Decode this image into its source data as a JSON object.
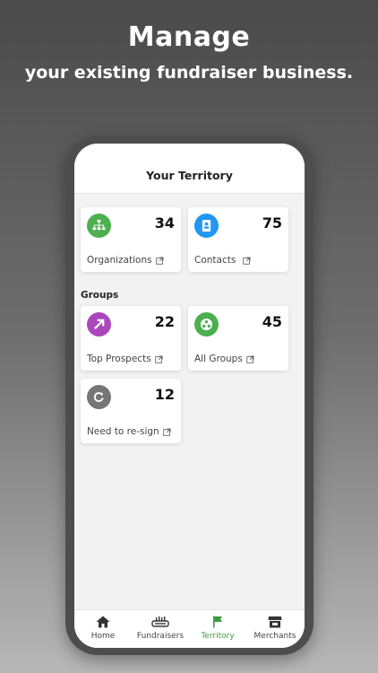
{
  "promo": {
    "headline": "Manage",
    "subheadline": "your existing fundraiser business."
  },
  "header": {
    "title": "Your Territory"
  },
  "cards": [
    {
      "label": "Organizations",
      "count": "34",
      "icon": "org-chart-icon",
      "color": "#4caf50"
    },
    {
      "label": "Contacts",
      "count": "75",
      "icon": "contact-card-icon",
      "color": "#2196f3"
    }
  ],
  "groups": {
    "title": "Groups",
    "cards": [
      {
        "label": "Top Prospects",
        "count": "22",
        "icon": "arrow-up-right-icon",
        "color": "#ab47bc"
      },
      {
        "label": "All Groups",
        "count": "45",
        "icon": "group-dots-icon",
        "color": "#4caf50"
      },
      {
        "label": "Need to re-sign",
        "count": "12",
        "icon": "refresh-icon",
        "color": "#757575"
      }
    ]
  },
  "tabs": [
    {
      "label": "Home",
      "icon": "home-icon",
      "active": false
    },
    {
      "label": "Fundraisers",
      "icon": "fundraiser-icon",
      "active": false
    },
    {
      "label": "Territory",
      "icon": "flag-icon",
      "active": true
    },
    {
      "label": "Merchants",
      "icon": "store-icon",
      "active": false
    }
  ],
  "colors": {
    "accent": "#3a9b3f"
  }
}
